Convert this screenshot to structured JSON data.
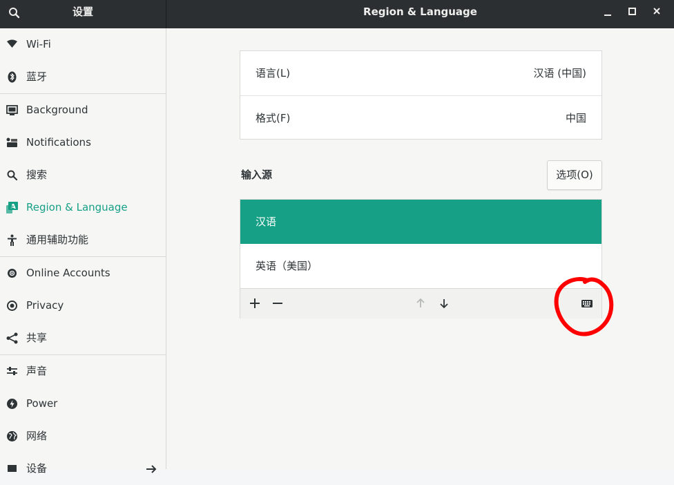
{
  "window": {
    "sidebar_title": "设置",
    "title": "Region & Language",
    "controls": [
      "minimize-icon",
      "maximize-icon",
      "close-icon"
    ]
  },
  "sidebar": {
    "items": [
      {
        "label": "Wi-Fi",
        "icon": "wifi-icon"
      },
      {
        "label": "蓝牙",
        "icon": "bluetooth-icon"
      },
      {
        "label": "Background",
        "icon": "background-icon"
      },
      {
        "label": "Notifications",
        "icon": "notifications-icon"
      },
      {
        "label": "搜索",
        "icon": "search-icon"
      },
      {
        "label": "Region & Language",
        "icon": "region-language-icon",
        "active": true
      },
      {
        "label": "通用辅助功能",
        "icon": "accessibility-icon"
      },
      {
        "label": "Online Accounts",
        "icon": "online-accounts-icon"
      },
      {
        "label": "Privacy",
        "icon": "privacy-icon"
      },
      {
        "label": "共享",
        "icon": "share-icon"
      },
      {
        "label": "声音",
        "icon": "sound-icon"
      },
      {
        "label": "Power",
        "icon": "power-icon"
      },
      {
        "label": "网络",
        "icon": "network-icon"
      },
      {
        "label": "设备",
        "icon": "devices-icon"
      }
    ]
  },
  "language_card": {
    "rows": [
      {
        "label": "语言(L)",
        "value": "汉语 (中国)"
      },
      {
        "label": "格式(F)",
        "value": "中国"
      }
    ]
  },
  "input_sources": {
    "title": "输入源",
    "options_button": "选项(O)",
    "sources": [
      {
        "label": "汉语",
        "selected": true
      },
      {
        "label": "英语（美国）",
        "selected": false
      }
    ],
    "toolbar": [
      "add-icon",
      "remove-icon",
      "move-up-icon",
      "move-down-icon",
      "keyboard-icon"
    ]
  },
  "colors": {
    "accent": "#16a085",
    "header": "#2b2f32",
    "annotation": "#ff0000"
  }
}
